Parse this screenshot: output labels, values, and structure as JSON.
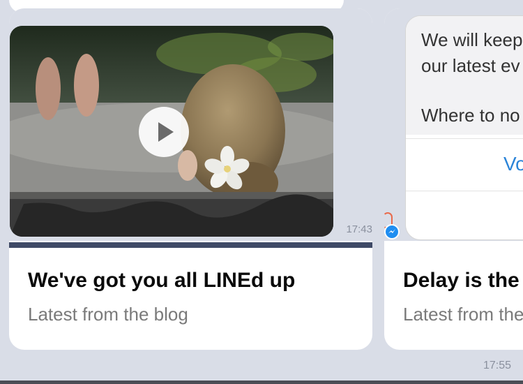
{
  "left_card": {
    "timestamp": "17:43",
    "title": "We've got you all LINEd up",
    "subtitle": "Latest from the blog"
  },
  "right_card": {
    "message_lines": [
      "We will keep",
      "our latest ev",
      "Where to no"
    ],
    "option_1": "Vo",
    "title": "Delay is the",
    "subtitle": "Latest from the"
  },
  "footer": {
    "time": "17:55"
  },
  "colors": {
    "background": "#d9dde7",
    "accent_bar": "#3f4a66",
    "link_blue": "#2b84d8",
    "messenger_blue": "#1f8ef1"
  },
  "icons": {
    "play": "play-icon",
    "messenger": "messenger-icon"
  }
}
